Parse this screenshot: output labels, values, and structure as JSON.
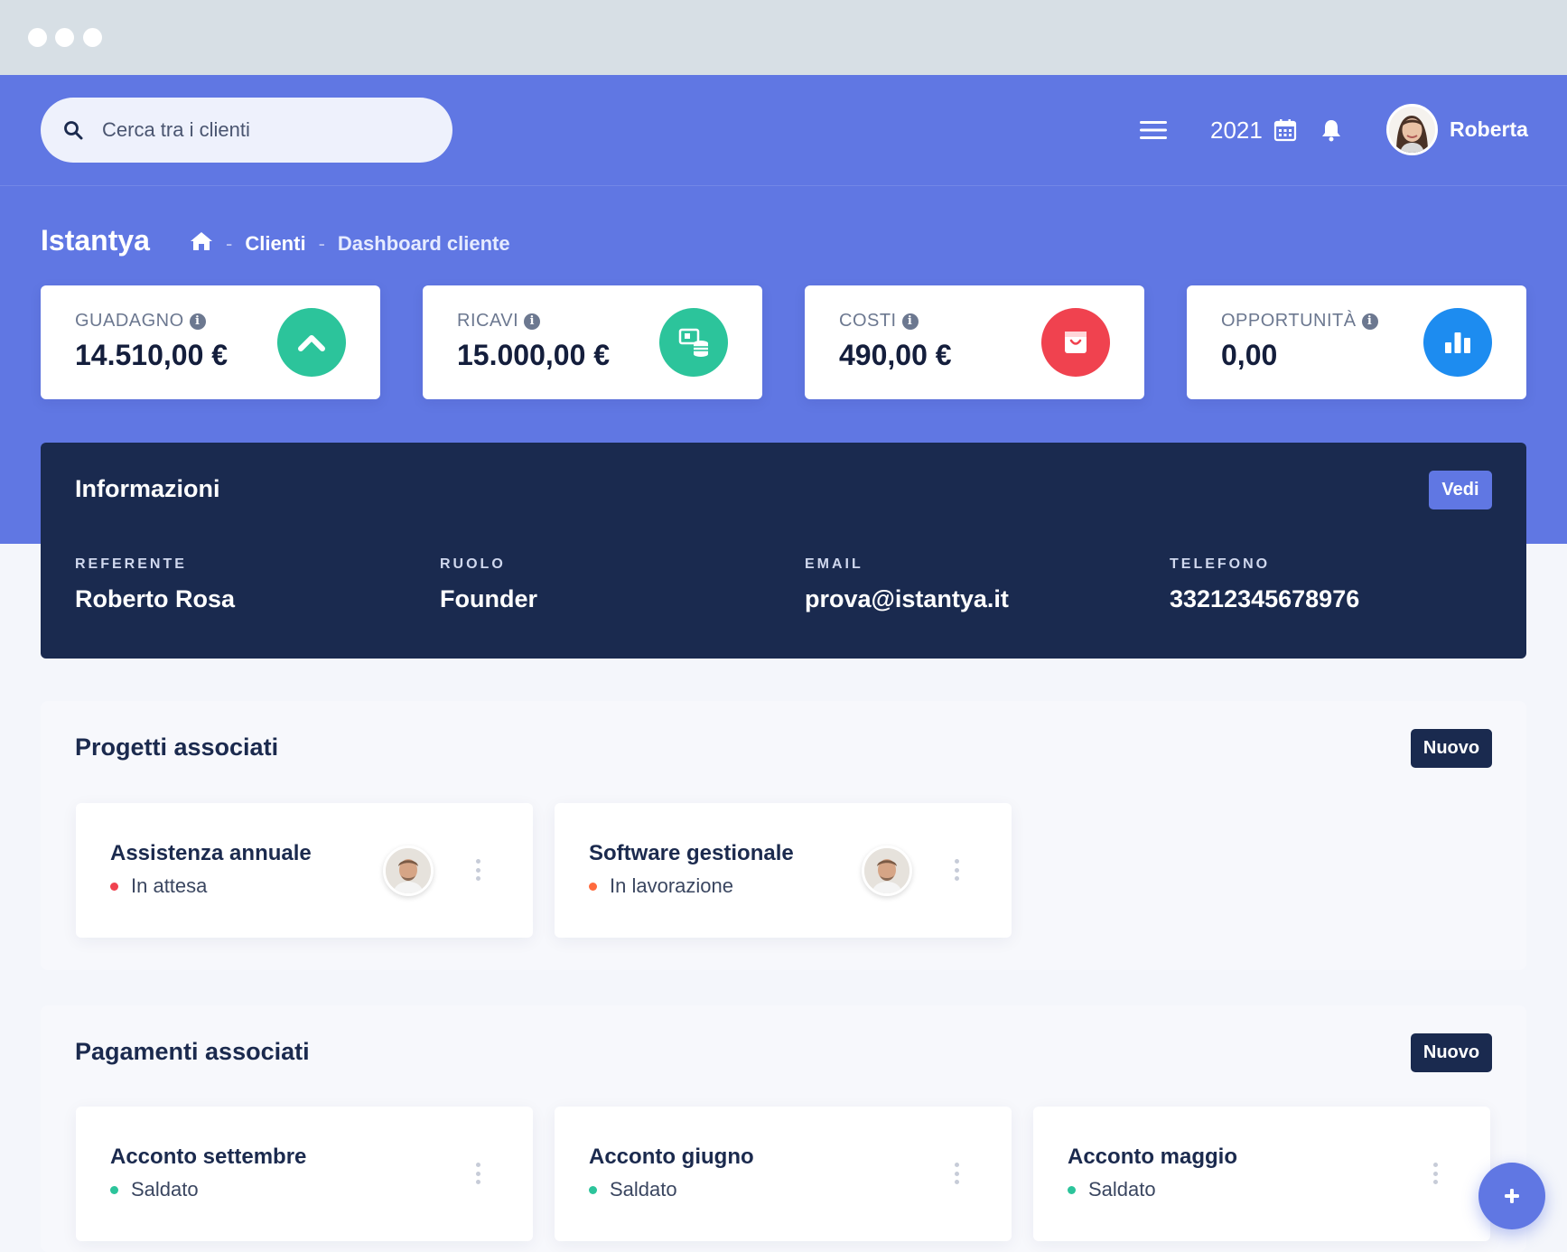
{
  "browser": {
    "dots": 3
  },
  "header": {
    "search": {
      "placeholder": "Cerca tra i clienti"
    },
    "menu_icon": "hamburger-icon",
    "year": "2021",
    "calendar_icon": "calendar-icon",
    "notification_icon": "bell-icon",
    "user": {
      "name": "Roberta"
    }
  },
  "page": {
    "title": "Istantya",
    "breadcrumb": {
      "home_icon": "home-icon",
      "sep": "-",
      "items": [
        "Clienti",
        "Dashboard cliente"
      ]
    }
  },
  "stats": [
    {
      "label": "GUADAGNO",
      "value": "14.510,00 €",
      "icon": "chevron-up-icon",
      "color": "#2cc49b"
    },
    {
      "label": "RICAVI",
      "value": "15.000,00 €",
      "icon": "money-icon",
      "color": "#2cc49b"
    },
    {
      "label": "COSTI",
      "value": "490,00 €",
      "icon": "shopping-bag-icon",
      "color": "#f0424f"
    },
    {
      "label": "OPPORTUNITÀ",
      "value": "0,00",
      "icon": "bar-chart-icon",
      "color": "#1d8cf0"
    }
  ],
  "info": {
    "title": "Informazioni",
    "button": "Vedi",
    "fields": [
      {
        "label": "REFERENTE",
        "value": "Roberto Rosa"
      },
      {
        "label": "RUOLO",
        "value": "Founder"
      },
      {
        "label": "EMAIL",
        "value": "prova@istantya.it"
      },
      {
        "label": "TELEFONO",
        "value": "33212345678976"
      }
    ]
  },
  "projects": {
    "title": "Progetti associati",
    "button": "Nuovo",
    "items": [
      {
        "title": "Assistenza annuale",
        "status": "In attesa",
        "status_color": "#f0424f"
      },
      {
        "title": "Software gestionale",
        "status": "In lavorazione",
        "status_color": "#ff6a3d"
      }
    ]
  },
  "payments": {
    "title": "Pagamenti associati",
    "button": "Nuovo",
    "items": [
      {
        "title": "Acconto settembre",
        "status": "Saldato",
        "status_color": "#2cc49b"
      },
      {
        "title": "Acconto giugno",
        "status": "Saldato",
        "status_color": "#2cc49b"
      },
      {
        "title": "Acconto maggio",
        "status": "Saldato",
        "status_color": "#2cc49b"
      }
    ]
  },
  "fab_icon": "plus-icon",
  "colors": {
    "primary": "#6077e3",
    "navy": "#1a2a4f"
  }
}
